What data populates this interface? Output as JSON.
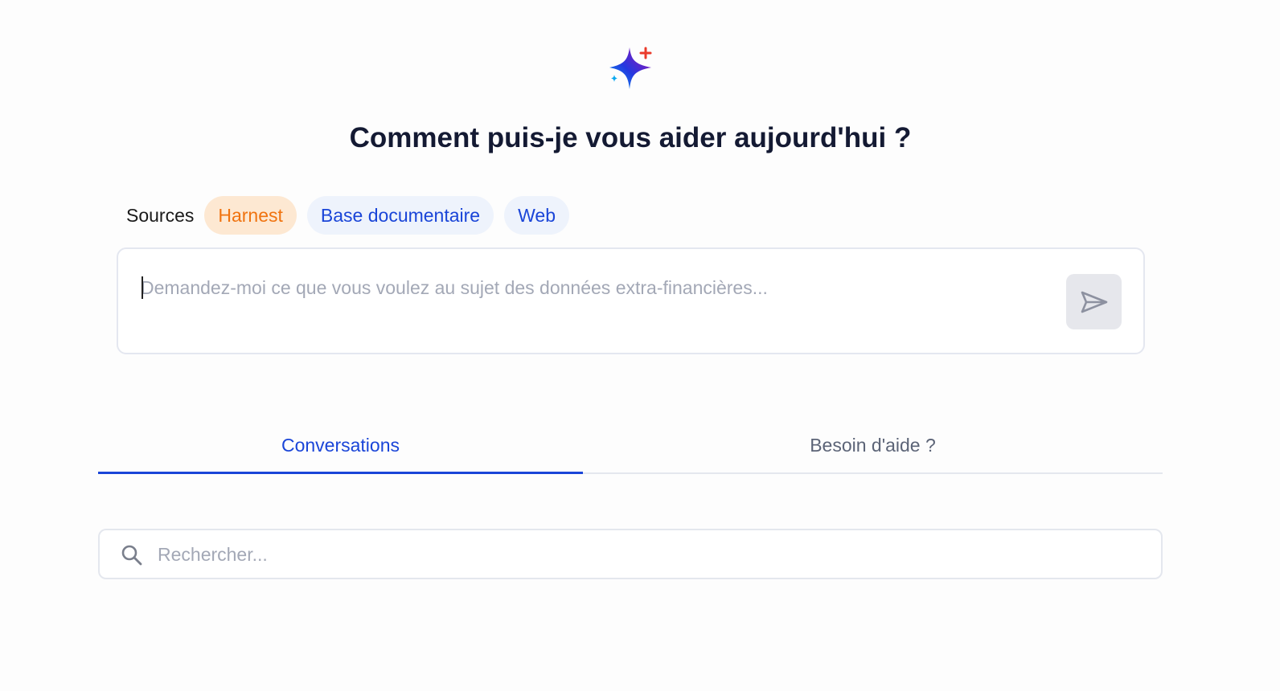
{
  "header": {
    "logo_icon": "sparkle-icon",
    "title": "Comment puis-je vous aider aujourd'hui ?"
  },
  "sources": {
    "label": "Sources",
    "chips": [
      {
        "label": "Harnest",
        "color": "#f0730f",
        "background": "#fde8d2"
      },
      {
        "label": "Base documentaire",
        "color": "#1a45d8",
        "background": "#eef3fc"
      },
      {
        "label": "Web",
        "color": "#1a45d8",
        "background": "#eef3fc"
      }
    ]
  },
  "prompt": {
    "placeholder": "Demandez-moi ce que vous voulez au sujet des données extra-financières...",
    "value": "",
    "send_icon": "send-icon"
  },
  "tabs": [
    {
      "label": "Conversations",
      "active": true
    },
    {
      "label": "Besoin d'aide ?",
      "active": false
    }
  ],
  "search": {
    "icon": "search-icon",
    "placeholder": "Rechercher...",
    "value": ""
  },
  "colors": {
    "accent": "#1a45d8",
    "harnest": "#f0730f",
    "title": "#141a33"
  }
}
